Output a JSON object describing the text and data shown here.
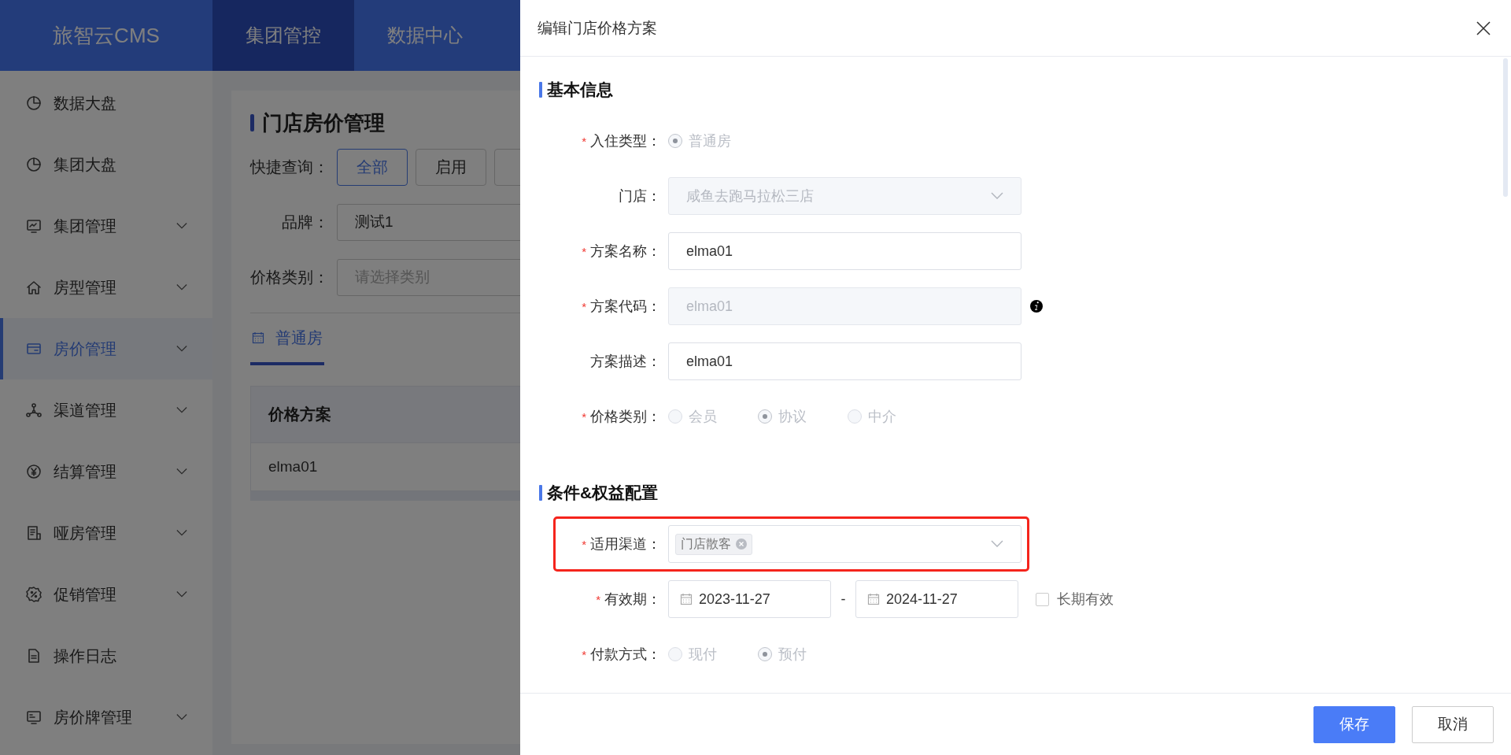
{
  "app": {
    "logo": "旅智云CMS",
    "nav": [
      {
        "label": "集团管控",
        "selected": true
      },
      {
        "label": "数据中心",
        "selected": false
      }
    ]
  },
  "sidebar": {
    "items": [
      {
        "label": "数据大盘",
        "expandable": false,
        "selected": false
      },
      {
        "label": "集团大盘",
        "expandable": false,
        "selected": false
      },
      {
        "label": "集团管理",
        "expandable": true,
        "selected": false
      },
      {
        "label": "房型管理",
        "expandable": true,
        "selected": false
      },
      {
        "label": "房价管理",
        "expandable": true,
        "selected": true
      },
      {
        "label": "渠道管理",
        "expandable": true,
        "selected": false
      },
      {
        "label": "结算管理",
        "expandable": true,
        "selected": false
      },
      {
        "label": "哑房管理",
        "expandable": true,
        "selected": false
      },
      {
        "label": "促销管理",
        "expandable": true,
        "selected": false
      },
      {
        "label": "操作日志",
        "expandable": false,
        "selected": false
      },
      {
        "label": "房价牌管理",
        "expandable": true,
        "selected": false
      }
    ]
  },
  "page": {
    "title": "门店房价管理",
    "quick_query": {
      "label": "快捷查询：",
      "options": [
        {
          "label": "全部",
          "selected": true
        },
        {
          "label": "启用",
          "selected": false
        },
        {
          "selected": false
        }
      ]
    },
    "filters": [
      {
        "label": "品牌：",
        "value": "测试1"
      },
      {
        "label": "价格类别：",
        "placeholder": "请选择类别"
      }
    ],
    "tabs": [
      {
        "label": "普通房",
        "selected": true
      }
    ],
    "table": {
      "columns": [
        "价格方案"
      ],
      "rows": [
        [
          "elma01"
        ]
      ]
    }
  },
  "drawer": {
    "title": "编辑门店价格方案",
    "sections": [
      {
        "title": "基本信息",
        "fields": [
          {
            "kind": "radio",
            "mark": "*",
            "label": "入住类型：",
            "disabled": true,
            "options": [
              {
                "label": "普通房",
                "selected": true
              }
            ]
          },
          {
            "kind": "select",
            "label": "门店：",
            "value": "咸鱼去跑马拉松三店",
            "disabled": true
          },
          {
            "kind": "input",
            "mark": "*",
            "label": "方案名称：",
            "value": "elma01",
            "disabled": false
          },
          {
            "kind": "input",
            "mark": "*",
            "label": "方案代码：",
            "value": "elma01",
            "disabled": true,
            "info": true
          },
          {
            "kind": "input",
            "label": "方案描述：",
            "value": "elma01",
            "disabled": false
          },
          {
            "kind": "radio",
            "mark": "*",
            "label": "价格类别：",
            "disabled": true,
            "options": [
              {
                "label": "会员",
                "selected": false
              },
              {
                "label": "协议",
                "selected": true
              },
              {
                "label": "中介",
                "selected": false
              }
            ]
          }
        ]
      },
      {
        "title": "条件&权益配置",
        "fields": [
          {
            "kind": "tags",
            "mark": "*",
            "label": "适用渠道：",
            "tags": [
              "门店散客"
            ],
            "highlighted": true
          },
          {
            "kind": "daterange",
            "mark": "*",
            "label": "有效期：",
            "start": "2023-11-27",
            "separator": "-",
            "end": "2024-11-27",
            "checkbox": {
              "label": "长期有效",
              "checked": false
            }
          },
          {
            "kind": "radio",
            "mark": "*",
            "label": "付款方式：",
            "disabled": true,
            "options": [
              {
                "label": "现付",
                "selected": false
              },
              {
                "label": "预付",
                "selected": true
              }
            ]
          }
        ]
      }
    ],
    "buttons": [
      {
        "label": "保存",
        "kind": "primary"
      },
      {
        "label": "取消",
        "kind": "default"
      }
    ]
  }
}
